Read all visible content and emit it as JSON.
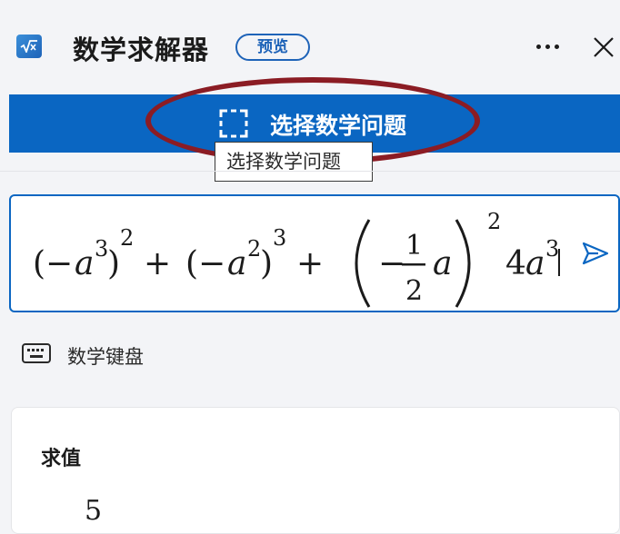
{
  "header": {
    "app_title": "数学求解器",
    "badge": "预览",
    "app_icon": "sqrt-x-icon",
    "more_icon": "more-horizontal-icon",
    "close_icon": "close-icon"
  },
  "select_button": {
    "label": "选择数学问题",
    "icon": "screen-select-frame-icon"
  },
  "tooltip": {
    "text": "选择数学问题"
  },
  "equation_input": {
    "expression": "(-a^3)^2 + (-a^2)^3 + (-1/2 a)^2 4a^3",
    "send_icon": "send-icon"
  },
  "keyboard": {
    "label": "数学键盘",
    "icon": "keyboard-icon"
  },
  "result": {
    "title": "求值",
    "value": "5"
  },
  "colors": {
    "accent": "#0a66c2",
    "highlight": "#8b1c24",
    "background": "#f3f4f7"
  }
}
